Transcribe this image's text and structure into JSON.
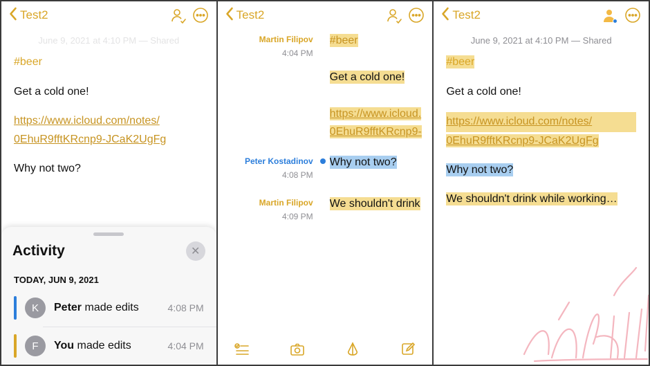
{
  "accent_gold": "#d9a627",
  "accent_blue": "#2c7edb",
  "header": {
    "back_label": "Test2"
  },
  "meta": {
    "timestamp_line": "June 9, 2021 at 4:10 PM — Shared"
  },
  "note": {
    "tag": "#beer",
    "line1": "Get a cold one!",
    "link_line1": "https://www.icloud.com/notes/",
    "link_line2": "0EhuR9fftKRcnp9-JCaK2UgFg",
    "line2": "Why not two?",
    "line3": "We shouldn't drink while working…"
  },
  "attrib": {
    "entries": [
      {
        "name": "Martin Filipov",
        "time": "4:04 PM",
        "color": "gold",
        "blocks": [
          "tag",
          "line1",
          "link"
        ]
      },
      {
        "name": "Peter Kostadinov",
        "time": "4:08 PM",
        "color": "blue",
        "blocks": [
          "line2"
        ]
      },
      {
        "name": "Martin Filipov",
        "time": "4:09 PM",
        "color": "gold",
        "blocks": [
          "line3_trunc"
        ]
      }
    ],
    "link_trunc1": "https://www.icloud.",
    "link_trunc2": "0EhuR9fftKRcnp9-",
    "line3_trunc": "We shouldn't drink"
  },
  "activity": {
    "title": "Activity",
    "date_label": "TODAY, JUN 9, 2021",
    "items": [
      {
        "avatar_initial": "K",
        "name": "Peter",
        "action": "made edits",
        "time": "4:08 PM",
        "bar_color": "blue"
      },
      {
        "avatar_initial": "F",
        "name": "You",
        "action": "made edits",
        "time": "4:04 PM",
        "bar_color": "gold"
      }
    ]
  },
  "icons": {
    "collaborate": "collaborate-icon",
    "more": "more-icon",
    "close": "close-icon",
    "checklist": "checklist-icon",
    "camera": "camera-icon",
    "markup": "markup-icon",
    "compose": "compose-icon",
    "back": "chevron-left-icon"
  }
}
